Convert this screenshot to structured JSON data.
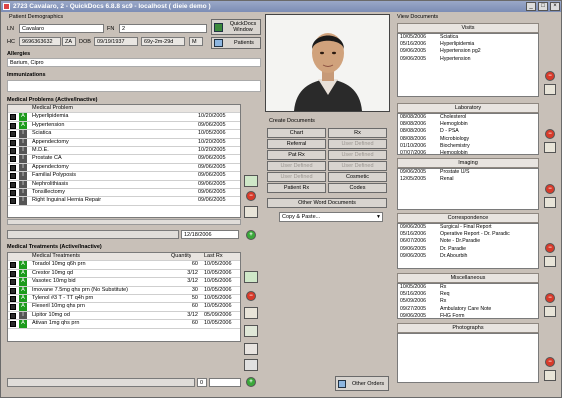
{
  "window": {
    "title": "2723 Cavalaro, 2 - QuickDocs 6.8.8 sc9 - localhost ( dieie demo )"
  },
  "demographics": {
    "header": "Patient Demographics",
    "ln_label": "LN",
    "ln_value": "Cavalaro",
    "fn_label": "FN",
    "fn_value": "2",
    "hc_label": "HC",
    "hc_value": "9696363632",
    "hc_code": "ZA",
    "dob_label": "DOB",
    "dob_value": "09/19/1937",
    "age_value": "69y-2m-29d",
    "sex_value": "M",
    "quickdocs_button": "QuickDocs Window",
    "patients_button": "Patients"
  },
  "allergies": {
    "header": "Allergies",
    "value": "Barium, Cipro"
  },
  "immunizations": {
    "header": "Immunizations"
  },
  "problems": {
    "header": "Medical Problems (Active/Inactive)",
    "column": "Medical Problem",
    "rows": [
      {
        "status": "A",
        "name": "Hyperlipidemia",
        "date": "10/20/2005"
      },
      {
        "status": "A",
        "name": "Hypertension",
        "date": "09/06/2005"
      },
      {
        "status": "I",
        "name": "Sciatica",
        "date": "10/05/2006"
      },
      {
        "status": "I",
        "name": "Appendectomy",
        "date": "10/20/2005"
      },
      {
        "status": "I",
        "name": "M.D.E.",
        "date": "10/20/2005"
      },
      {
        "status": "I",
        "name": "Prostate CA",
        "date": "09/06/2005"
      },
      {
        "status": "I",
        "name": "Appendectomy",
        "date": "09/06/2005"
      },
      {
        "status": "I",
        "name": "Familial Polyposis",
        "date": "09/06/2005"
      },
      {
        "status": "I",
        "name": "Nephrolithiasis",
        "date": "09/06/2005"
      },
      {
        "status": "I",
        "name": "Tonsillectomy",
        "date": "09/06/2005"
      },
      {
        "status": "I",
        "name": "Right Inguinal Hernia Repair",
        "date": "09/06/2005"
      }
    ],
    "date_field": "12/18/2006"
  },
  "treatments": {
    "header": "Medical Treatments (Active/Inactive)",
    "columns": {
      "name": "Medical Treatments",
      "qty": "Quantity",
      "last": "Last Rx"
    },
    "rows": [
      {
        "status": "A",
        "name": "Toradol 10mg q6h prn",
        "qty": "60",
        "last": "10/05/2006"
      },
      {
        "status": "A",
        "name": "Crestor 10mg qd",
        "qty": "3/12",
        "last": "10/05/2006"
      },
      {
        "status": "A",
        "name": "Vasotec 10mg bid",
        "qty": "3/12",
        "last": "10/05/2006"
      },
      {
        "status": "A",
        "name": "Imovane 7.5mg qhs prn (No Substitute)",
        "qty": "30",
        "last": "10/05/2006"
      },
      {
        "status": "A",
        "name": "Tylenol #3 T - TT q4h prn",
        "qty": "50",
        "last": "10/05/2006"
      },
      {
        "status": "A",
        "name": "Flexeril 10mg qhs prn",
        "qty": "60",
        "last": "10/05/2006"
      },
      {
        "status": "I",
        "name": "Lipitor 10mg od",
        "qty": "3/12",
        "last": "05/09/2006"
      },
      {
        "status": "A",
        "name": "Ativan 1mg qhs prn",
        "qty": "60",
        "last": "10/05/2006"
      }
    ],
    "bottom_field": "0"
  },
  "create_documents": {
    "header": "Create Documents",
    "buttons": [
      [
        "Chart",
        "Rx"
      ],
      [
        "Referral",
        "User Defined"
      ],
      [
        "Pat Rx",
        "User Defined"
      ],
      [
        "User Defined",
        "User Defined"
      ],
      [
        "User Defined",
        "Cosmetic"
      ],
      [
        "Patient Rx",
        "Codes"
      ]
    ],
    "other_word": "Other Word Documents",
    "copy_paste": "Copy & Paste...",
    "other_orders": "Other Orders"
  },
  "view_documents": {
    "header": "View Documents",
    "sections": [
      {
        "title": "Visits",
        "rows": [
          [
            "10/05/2006",
            "Sciatica"
          ],
          [
            "05/16/2006",
            "Hyperlipidemia"
          ],
          [
            "09/06/2005",
            "Hypertension pg2"
          ],
          [
            "09/06/2005",
            "Hypertension"
          ]
        ]
      },
      {
        "title": "Laboratory",
        "rows": [
          [
            "08/08/2006",
            "Cholesterol"
          ],
          [
            "08/08/2006",
            "Hemoglobin"
          ],
          [
            "08/08/2006",
            "D - PSA"
          ],
          [
            "08/08/2006",
            "Microbiology"
          ],
          [
            "01/10/2006",
            "Biochemistry"
          ],
          [
            "07/07/2006",
            "Hemoglobin"
          ]
        ]
      },
      {
        "title": "Imaging",
        "rows": [
          [
            "09/06/2005",
            "Prostate U/S"
          ],
          [
            "12/05/2005",
            "Renal"
          ]
        ]
      },
      {
        "title": "Correspondence",
        "rows": [
          [
            "09/06/2005",
            "Surgical - Final Report"
          ],
          [
            "05/16/2006",
            "Operative Report - Dr. Paradic"
          ],
          [
            "06/07/2006",
            "Note - Dr.Paradie"
          ],
          [
            "09/06/2005",
            "Dr. Paradie"
          ],
          [
            "09/06/2005",
            "Dr.Abourbih"
          ]
        ]
      },
      {
        "title": "Miscellaneous",
        "rows": [
          [
            "10/05/2006",
            "Rx"
          ],
          [
            "05/16/2006",
            "Req"
          ],
          [
            "05/09/2006",
            "Rx"
          ],
          [
            "09/27/2005",
            "Ambulatory Care Note"
          ],
          [
            "09/06/2005",
            "FHG Form"
          ]
        ]
      },
      {
        "title": "Photographs",
        "rows": []
      }
    ]
  },
  "colors": {
    "active": "#1c9a1c",
    "inactive": "#555555",
    "delete": "#d83a2a",
    "add": "#3aa83a"
  }
}
